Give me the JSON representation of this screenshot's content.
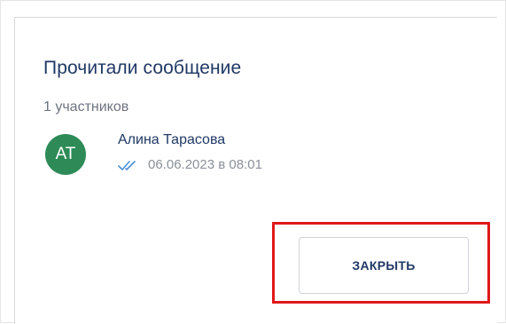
{
  "dialog": {
    "title": "Прочитали сообщение",
    "subtitle": "1 участников",
    "participants": [
      {
        "initials": "АТ",
        "name": "Алина Тарасова",
        "read_status_icon": "double-check-icon",
        "read_time": "06.06.2023 в 08:01",
        "avatar_color": "#2e8b57"
      }
    ],
    "close_label": "ЗАКРЫТЬ"
  },
  "colors": {
    "title": "#1f3864",
    "check": "#4a90d9",
    "highlight": "#e01818"
  }
}
